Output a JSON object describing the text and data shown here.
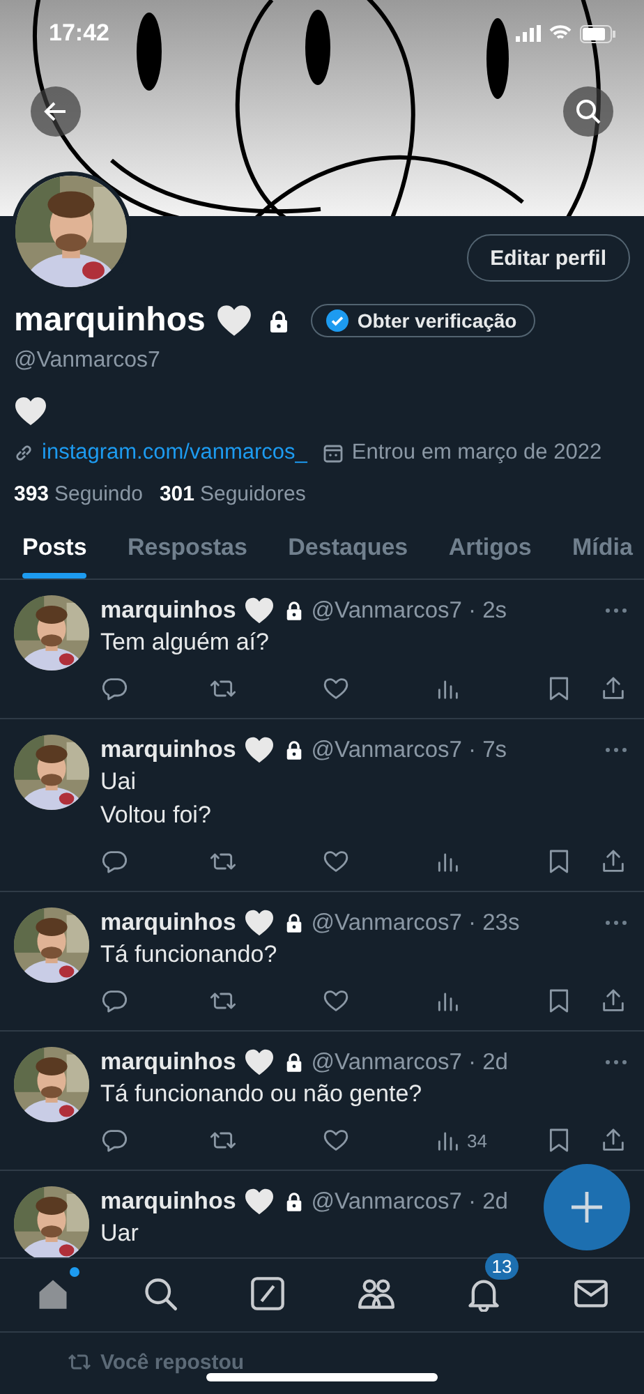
{
  "status_bar": {
    "time": "17:42"
  },
  "profile": {
    "edit_button": "Editar perfil",
    "name": "marquinhos",
    "verify_button": "Obter verificação",
    "handle": "@Vanmarcos7",
    "link": "instagram.com/vanmarcos_",
    "joined": "Entrou em março de 2022",
    "following_count": "393",
    "following_label": "Seguindo",
    "followers_count": "301",
    "followers_label": "Seguidores"
  },
  "tabs": [
    {
      "label": "Posts",
      "selected": true
    },
    {
      "label": "Respostas",
      "selected": false
    },
    {
      "label": "Destaques",
      "selected": false
    },
    {
      "label": "Artigos",
      "selected": false
    },
    {
      "label": "Mídia",
      "selected": false
    }
  ],
  "posts": [
    {
      "name": "marquinhos",
      "meta": "@Vanmarcos7 · 2s",
      "lines": [
        "Tem alguém aí?"
      ],
      "actions": true
    },
    {
      "name": "marquinhos",
      "meta": "@Vanmarcos7 · 7s",
      "lines": [
        "Uai",
        "Voltou foi?"
      ],
      "actions": true
    },
    {
      "name": "marquinhos",
      "meta": "@Vanmarcos7 · 23s",
      "lines": [
        "Tá funcionando?"
      ],
      "actions": true
    },
    {
      "name": "marquinhos",
      "meta": "@Vanmarcos7 · 2d",
      "lines": [
        "Tá funcionando ou não gente?"
      ],
      "actions": true,
      "views": "34"
    },
    {
      "name": "marquinhos",
      "meta": "@Vanmarcos7 · 2d",
      "lines": [
        "Uar"
      ],
      "actions": false
    }
  ],
  "bottom_nav": [
    {
      "kind": "home",
      "selected": true,
      "dot": true
    },
    {
      "kind": "search",
      "selected": false
    },
    {
      "kind": "grok",
      "selected": false
    },
    {
      "kind": "communities",
      "selected": false
    },
    {
      "kind": "notifications",
      "selected": false,
      "badge": "13"
    },
    {
      "kind": "messages",
      "selected": false
    }
  ],
  "repost_note": "Você repostou"
}
